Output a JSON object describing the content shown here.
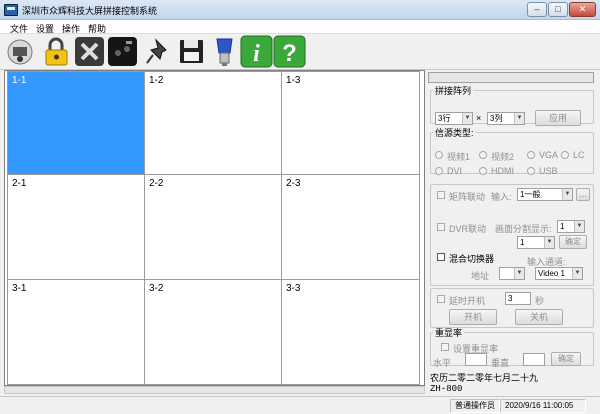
{
  "window": {
    "title": "深圳市众辉科技大屏拼接控制系统",
    "minimize": "–",
    "maximize": "□",
    "close": "✕"
  },
  "menu": [
    "文件",
    "设置",
    "操作",
    "帮助"
  ],
  "toolbar": [
    "connect-icon",
    "lock-icon",
    "tools-icon",
    "remote-icon",
    "pin-icon",
    "save-icon",
    "serial-port-icon",
    "info-icon",
    "help-icon"
  ],
  "grid": {
    "selected": "1-1",
    "cells": [
      "1-1",
      "1-2",
      "1-3",
      "2-1",
      "2-2",
      "2-3",
      "3-1",
      "3-2",
      "3-3"
    ]
  },
  "splice": {
    "title": "拼接阵列",
    "rows": "3行",
    "times": "×",
    "cols": "3列",
    "apply": "应用"
  },
  "source": {
    "title": "信源类型:",
    "options": [
      "视频1",
      "视频2",
      "VGA",
      "LC",
      "DVI",
      "HDMI",
      "USB"
    ]
  },
  "matrix": {
    "link_label": "矩阵联动",
    "input_label": "输入:",
    "input_value": "1一般",
    "more": "...",
    "dvr_label": "DVR联动",
    "split_label": "画面分割显示:",
    "split_value": "1",
    "channel_value": "1",
    "confirm": "确定"
  },
  "hybrid": {
    "switcher_label": "混合切换器",
    "channel_label": "输入通道:",
    "address_label": "地址",
    "channel_value": "Video 1"
  },
  "timer": {
    "label": "延时开机",
    "seconds_value": "3",
    "seconds_unit": "秒",
    "power_on": "开机",
    "power_off": "关机"
  },
  "refresh": {
    "title": "重显率",
    "set_label": "设置重显率",
    "horizontal_label": "水平",
    "vertical_label": "垂直",
    "confirm": "确定"
  },
  "lunar_date": "农历二零二零年七月二十九",
  "model": "ZH-800",
  "status": {
    "user": "普通操作员",
    "datetime": "2020/9/16 11:00:05"
  },
  "colors": {
    "selection": "#3399ff",
    "titlebar": "#c2d6ee",
    "disabled_text": "#8f8f8f"
  }
}
